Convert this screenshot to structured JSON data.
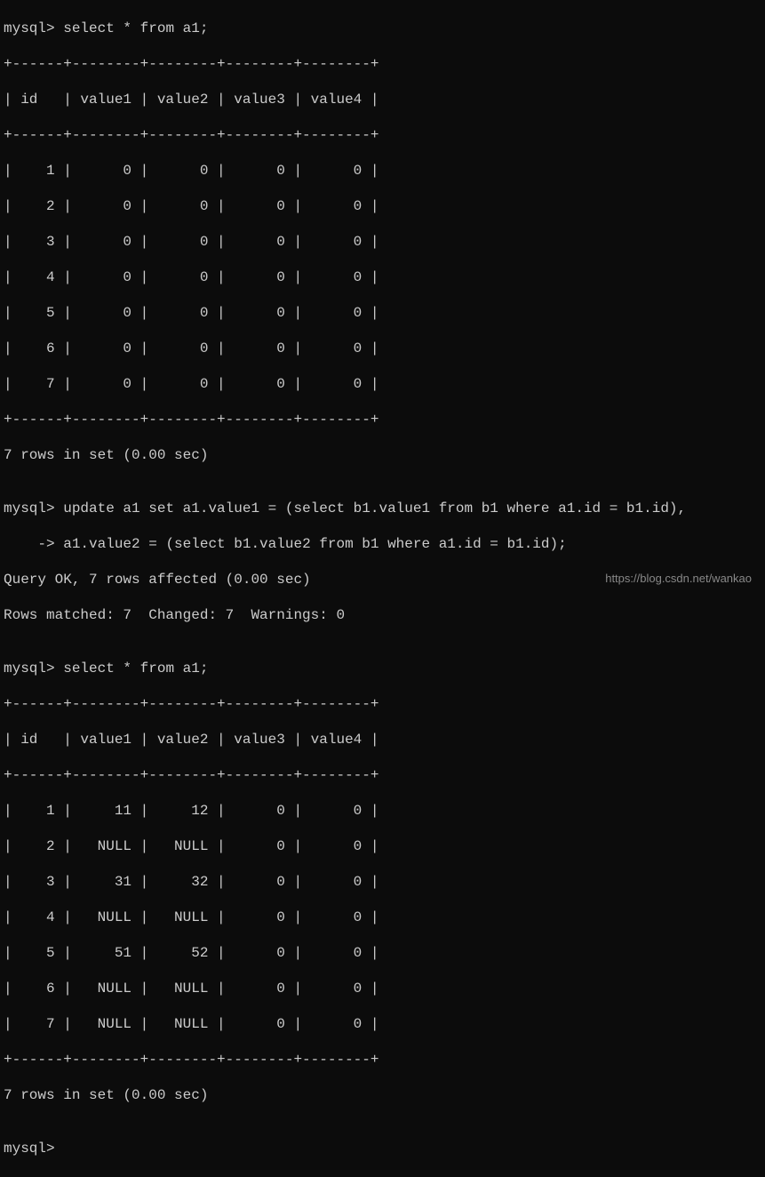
{
  "terminal": {
    "prompt": "mysql>",
    "continuation_prompt": "    ->",
    "query1": "select * from a1;",
    "border_top1": "+------+--------+--------+--------+--------+",
    "header1": "| id   | value1 | value2 | value3 | value4 |",
    "border_mid1": "+------+--------+--------+--------+--------+",
    "rows1": [
      "|    1 |      0 |      0 |      0 |      0 |",
      "|    2 |      0 |      0 |      0 |      0 |",
      "|    3 |      0 |      0 |      0 |      0 |",
      "|    4 |      0 |      0 |      0 |      0 |",
      "|    5 |      0 |      0 |      0 |      0 |",
      "|    6 |      0 |      0 |      0 |      0 |",
      "|    7 |      0 |      0 |      0 |      0 |"
    ],
    "border_bot1": "+------+--------+--------+--------+--------+",
    "result1": "7 rows in set (0.00 sec)",
    "blank": "",
    "query2_line1": "update a1 set a1.value1 = (select b1.value1 from b1 where a1.id = b1.id),",
    "query2_line2": "a1.value2 = (select b1.value2 from b1 where a1.id = b1.id);",
    "query2_result1": "Query OK, 7 rows affected (0.00 sec)",
    "query2_result2": "Rows matched: 7  Changed: 7  Warnings: 0",
    "query3": "select * from a1;",
    "border_top2": "+------+--------+--------+--------+--------+",
    "header2": "| id   | value1 | value2 | value3 | value4 |",
    "border_mid2": "+------+--------+--------+--------+--------+",
    "rows2": [
      "|    1 |     11 |     12 |      0 |      0 |",
      "|    2 |   NULL |   NULL |      0 |      0 |",
      "|    3 |     31 |     32 |      0 |      0 |",
      "|    4 |   NULL |   NULL |      0 |      0 |",
      "|    5 |     51 |     52 |      0 |      0 |",
      "|    6 |   NULL |   NULL |      0 |      0 |",
      "|    7 |   NULL |   NULL |      0 |      0 |"
    ],
    "border_bot2": "+------+--------+--------+--------+--------+",
    "result2": "7 rows in set (0.00 sec)",
    "cursor_line": "mysql>"
  },
  "watermark": "https://blog.csdn.net/wankao",
  "chart_data": {
    "type": "table",
    "table1": {
      "title": "a1 (before update)",
      "columns": [
        "id",
        "value1",
        "value2",
        "value3",
        "value4"
      ],
      "rows": [
        [
          1,
          0,
          0,
          0,
          0
        ],
        [
          2,
          0,
          0,
          0,
          0
        ],
        [
          3,
          0,
          0,
          0,
          0
        ],
        [
          4,
          0,
          0,
          0,
          0
        ],
        [
          5,
          0,
          0,
          0,
          0
        ],
        [
          6,
          0,
          0,
          0,
          0
        ],
        [
          7,
          0,
          0,
          0,
          0
        ]
      ]
    },
    "table2": {
      "title": "a1 (after update)",
      "columns": [
        "id",
        "value1",
        "value2",
        "value3",
        "value4"
      ],
      "rows": [
        [
          1,
          11,
          12,
          0,
          0
        ],
        [
          2,
          null,
          null,
          0,
          0
        ],
        [
          3,
          31,
          32,
          0,
          0
        ],
        [
          4,
          null,
          null,
          0,
          0
        ],
        [
          5,
          51,
          52,
          0,
          0
        ],
        [
          6,
          null,
          null,
          0,
          0
        ],
        [
          7,
          null,
          null,
          0,
          0
        ]
      ]
    }
  }
}
